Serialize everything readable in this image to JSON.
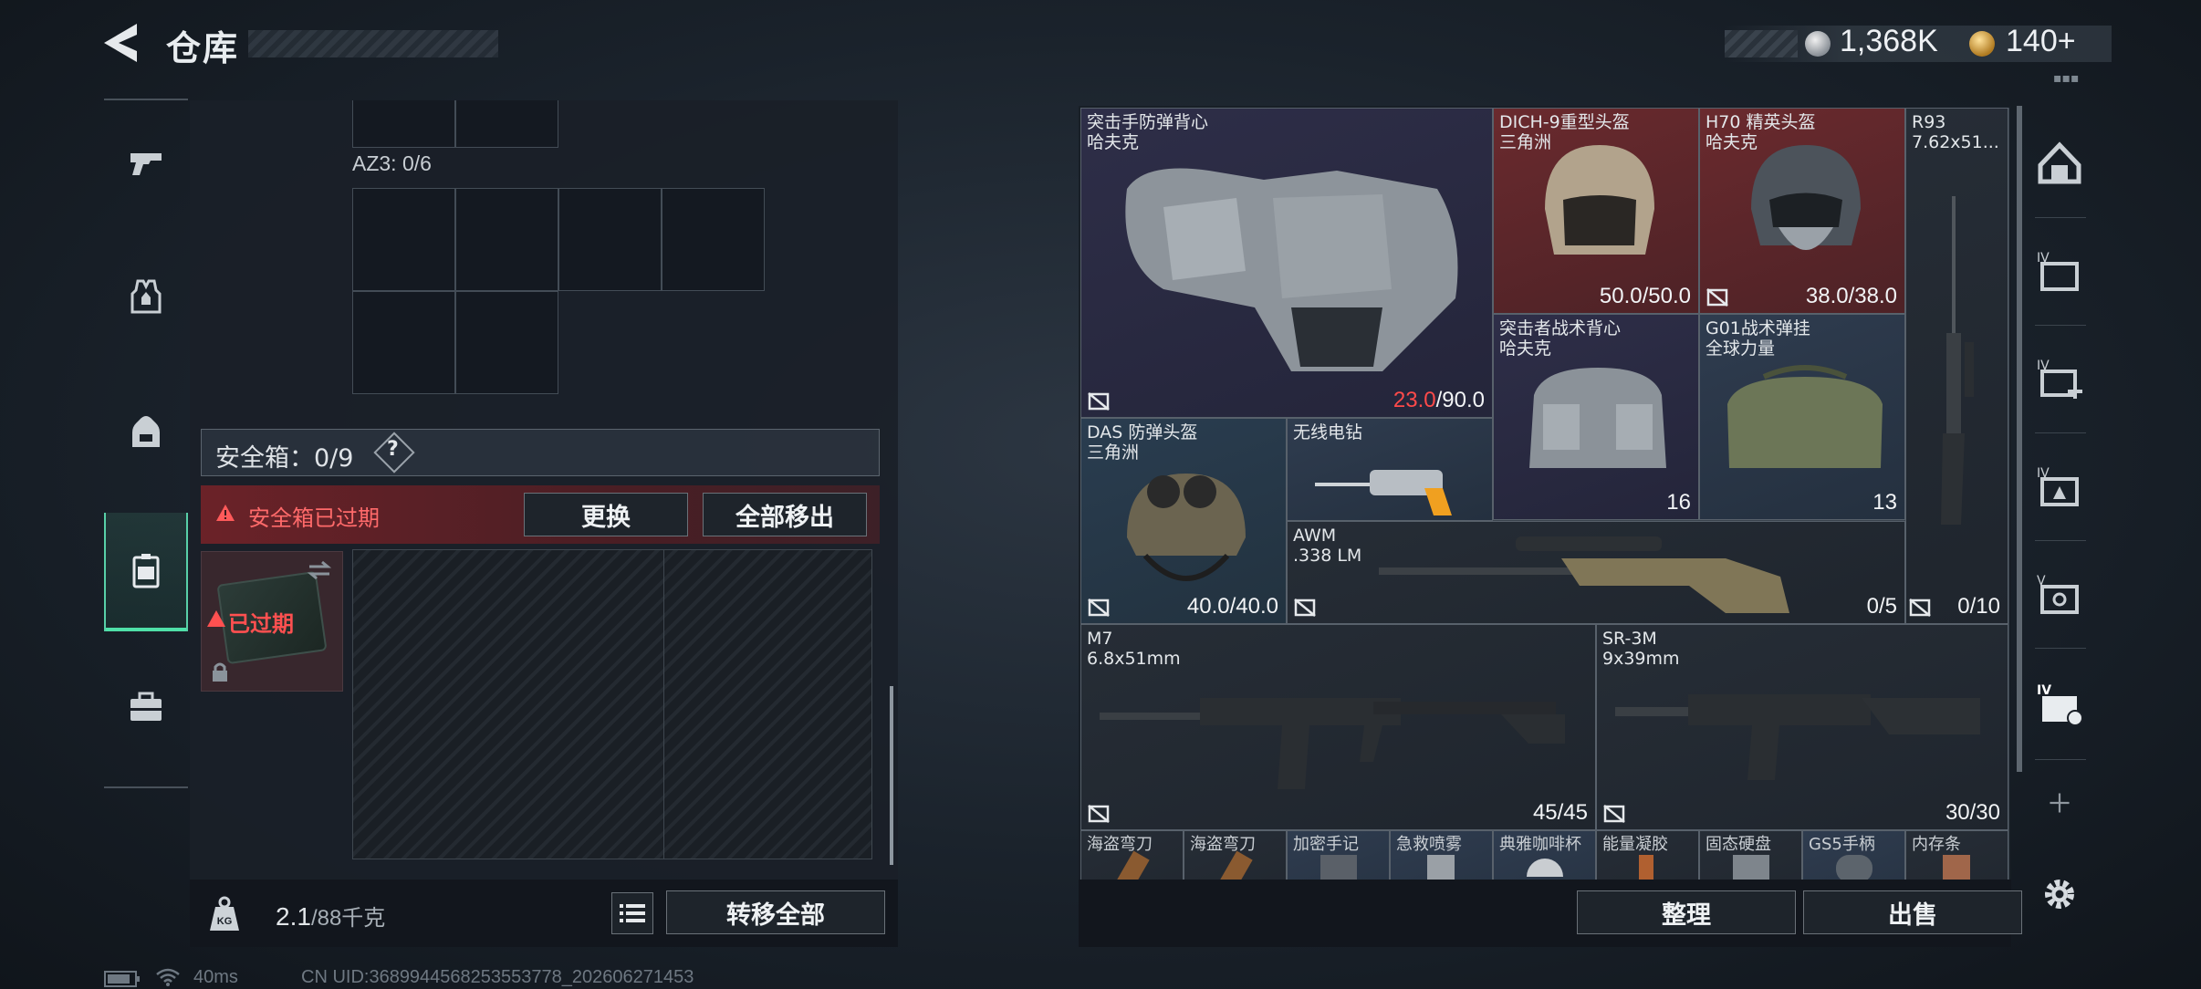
{
  "header": {
    "title": "仓库",
    "currency_silver": "1,368K",
    "currency_gold": "140+"
  },
  "left_tabs": [
    {
      "name": "weapons",
      "icon": "pistol-icon"
    },
    {
      "name": "armor",
      "icon": "vest-icon"
    },
    {
      "name": "backpack",
      "icon": "backpack-icon"
    },
    {
      "name": "safebox",
      "icon": "safebox-icon",
      "active": true
    },
    {
      "name": "toolbox",
      "icon": "briefcase-icon"
    }
  ],
  "left_panel": {
    "az3_label": "AZ3: 0/6",
    "safebox_label": "安全箱：0/9",
    "help": "?",
    "expired_notice": "安全箱已过期",
    "replace_button": "更换",
    "move_all_out_button": "全部移出",
    "box_expired_tag": "已过期",
    "weight_value": "2.1",
    "weight_max": "/88千克",
    "transfer_all_button": "转移全部"
  },
  "items": [
    {
      "name": "突击手防弹背心",
      "sub": "哈夫克",
      "value": "/90.0",
      "value_red": "23.0"
    },
    {
      "name": "DICH-9重型头盔",
      "sub": "三角洲",
      "value": "50.0/50.0"
    },
    {
      "name": "H70 精英头盔",
      "sub": "哈夫克",
      "value": "38.0/38.0"
    },
    {
      "name": "R93",
      "sub": "7.62x51...",
      "value": "0/10"
    },
    {
      "name": "突击者战术背心",
      "sub": "哈夫克",
      "value": "16"
    },
    {
      "name": "G01战术弹挂",
      "sub": "全球力量",
      "value": "13"
    },
    {
      "name": "DAS 防弹头盔",
      "sub": "三角洲",
      "value": "40.0/40.0"
    },
    {
      "name": "无线电钻",
      "sub": "",
      "value": ""
    },
    {
      "name": "AWM",
      "sub": ".338 LM",
      "value": "0/5"
    },
    {
      "name": "M7",
      "sub": "6.8x51mm",
      "value": "45/45"
    },
    {
      "name": "SR-3M",
      "sub": "9x39mm",
      "value": "30/30"
    }
  ],
  "small_items": [
    "海盗弯刀",
    "海盗弯刀",
    "加密手记",
    "急救喷雾",
    "典雅咖啡杯",
    "能量凝胶",
    "固态硬盘",
    "GS5手柄",
    "内存条"
  ],
  "right_bottom": {
    "sort_button": "整理",
    "sell_button": "出售"
  },
  "status_bar": {
    "ping": "40ms",
    "uid": "CN UID:3689944568253553778_202606271453"
  },
  "colors": {
    "accent_green": "#4fe0a8",
    "warning_red": "#ff4a4a",
    "legend_red": "#6a2a2e",
    "epic_purple": "#2e2e48",
    "rare_blue": "#2f3c4f"
  }
}
